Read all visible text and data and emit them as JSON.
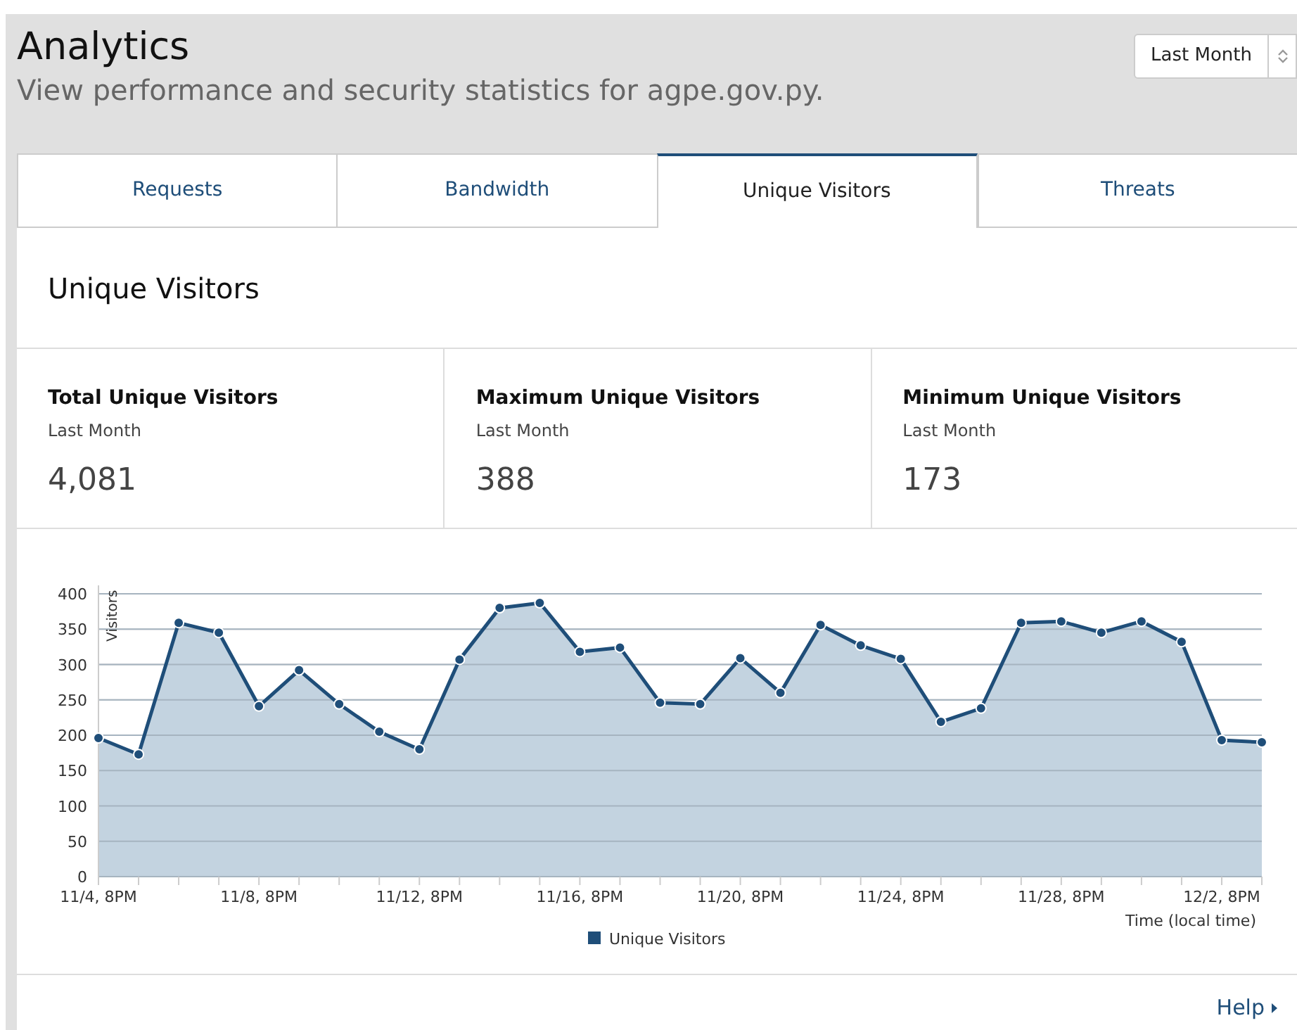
{
  "header": {
    "title": "Analytics",
    "subtitle": "View performance and security statistics for agpe.gov.py.",
    "period_select": {
      "value": "Last Month"
    }
  },
  "tabs": [
    {
      "label": "Requests",
      "selected": false
    },
    {
      "label": "Bandwidth",
      "selected": false
    },
    {
      "label": "Unique Visitors",
      "selected": true
    },
    {
      "label": "Threats",
      "selected": false
    }
  ],
  "panel_title": "Unique Visitors",
  "stats": [
    {
      "label": "Total Unique Visitors",
      "period": "Last Month",
      "value": "4,081"
    },
    {
      "label": "Maximum Unique Visitors",
      "period": "Last Month",
      "value": "388"
    },
    {
      "label": "Minimum Unique Visitors",
      "period": "Last Month",
      "value": "173"
    }
  ],
  "chart_data": {
    "type": "area",
    "xlabel": "Time (local time)",
    "ylabel": "Visitors",
    "categories": [
      "11/4, 8PM",
      null,
      null,
      null,
      "11/8, 8PM",
      null,
      null,
      null,
      "11/12, 8PM",
      null,
      null,
      null,
      "11/16, 8PM",
      null,
      null,
      null,
      "11/20, 8PM",
      null,
      null,
      null,
      "11/24, 8PM",
      null,
      null,
      null,
      "11/28, 8PM",
      null,
      null,
      null,
      "12/2, 8PM",
      null
    ],
    "series": [
      {
        "name": "Unique Visitors",
        "color": "#1f4e79",
        "values": [
          196,
          173,
          359,
          345,
          241,
          292,
          244,
          205,
          180,
          307,
          380,
          387,
          318,
          324,
          246,
          244,
          309,
          260,
          356,
          327,
          308,
          219,
          238,
          359,
          361,
          345,
          361,
          332,
          193,
          190
        ]
      }
    ],
    "ylim": [
      0,
      400
    ],
    "grid": true,
    "yticks": [
      0,
      50,
      100,
      150,
      200,
      250,
      300,
      350,
      400
    ]
  },
  "help_link": "Help"
}
